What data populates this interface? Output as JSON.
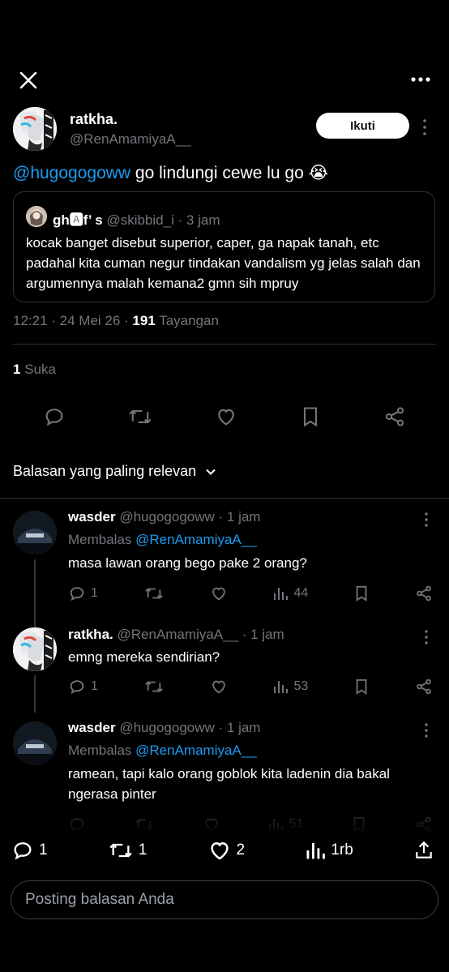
{
  "post": {
    "author_name": "ratkha.",
    "author_handle": "@RenAmamiyaA__",
    "follow_label": "Ikuti",
    "mention": "@hugogogoww",
    "text": " go lindungi cewe lu go 😭",
    "quote": {
      "name": "gh🅰f’ s",
      "handle": "@skibbid_i",
      "time": "· 3 jam",
      "text": "kocak banget disebut superior, caper, ga napak tanah, etc padahal kita cuman negur tindakan vandalism yg jelas salah dan argumennya malah kemana2 gmn sih mpruy"
    },
    "time": "12:21 · 24 Mei 26 · ",
    "views_count": "191",
    "views_label": " Tayangan",
    "likes_count": "1",
    "likes_label": " Suka"
  },
  "sort_label": "Balasan yang paling relevan",
  "replies": [
    {
      "name": "wasder",
      "handle": "@hugogogoww",
      "time": "· 1 jam",
      "replying_prefix": "Membalas ",
      "replying_to": "@RenAmamiyaA__",
      "text": "masa lawan orang bego pake 2 orang?",
      "reply_count": "1",
      "views": "44"
    },
    {
      "name": "ratkha.",
      "handle": "@RenAmamiyaA__",
      "time": "· 1 jam",
      "text": "emng mereka sendirian?",
      "reply_count": "1",
      "views": "53"
    },
    {
      "name": "wasder",
      "handle": "@hugogogoww",
      "time": "· 1 jam",
      "replying_prefix": "Membalas ",
      "replying_to": "@RenAmamiyaA__",
      "text_line1": "ramean, tapi kalo orang goblok kita ladenin dia bakal",
      "text_line2": "ngerasa pinter",
      "views": "51"
    }
  ],
  "bottom_bar": {
    "replies": "1",
    "reposts": "1",
    "likes": "2",
    "views": "1rb"
  },
  "reply_placeholder": "Posting balasan Anda",
  "colors": {
    "accent": "#1d9bf0",
    "muted": "#71767b",
    "background": "#000000"
  }
}
